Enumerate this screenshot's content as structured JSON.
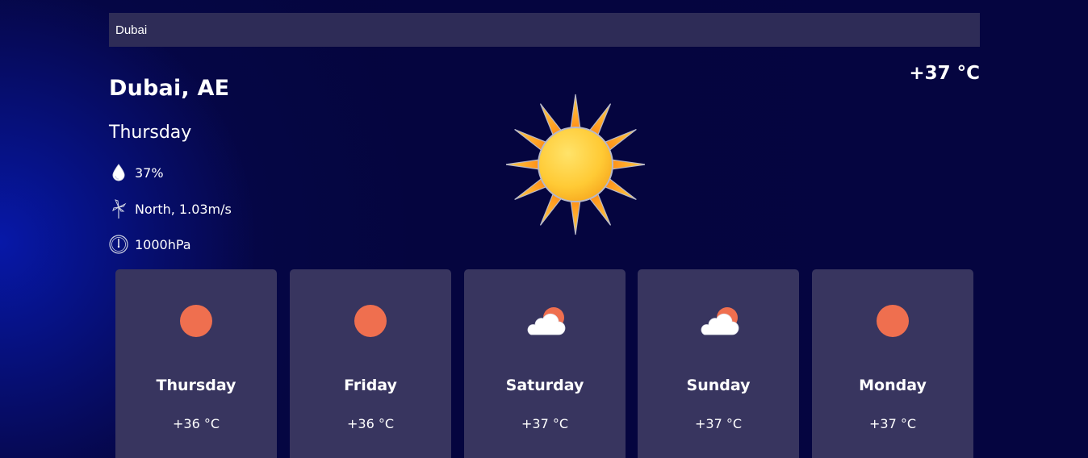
{
  "search": {
    "value": "Dubai"
  },
  "current": {
    "location": "Dubai, AE",
    "temperature": "+37 °C",
    "day": "Thursday",
    "humidity": "37%",
    "wind": "North, 1.03m/s",
    "pressure": "1000hPa",
    "icon": "sun-icon"
  },
  "forecast": [
    {
      "day": "Thursday",
      "temp": "+36 °C",
      "icon": "sun-icon"
    },
    {
      "day": "Friday",
      "temp": "+36 °C",
      "icon": "sun-icon"
    },
    {
      "day": "Saturday",
      "temp": "+37 °C",
      "icon": "partly-cloudy-icon"
    },
    {
      "day": "Sunday",
      "temp": "+37 °C",
      "icon": "partly-cloudy-icon"
    },
    {
      "day": "Monday",
      "temp": "+37 °C",
      "icon": "sun-icon"
    }
  ],
  "colors": {
    "background": "#05053a",
    "glow": "#0718a8",
    "search_bg": "#2e2c57",
    "card_bg": "#38355f",
    "forecast_sun": "#ef6f4f",
    "sun_core": "#ffd34a",
    "sun_ray": "#ff9f1a"
  }
}
